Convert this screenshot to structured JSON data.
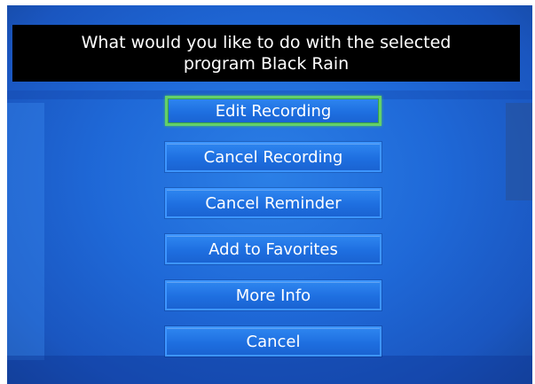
{
  "dialog": {
    "title_line1": "What would you like to do with the selected",
    "title_line2": "program Black Rain"
  },
  "menu": {
    "items": [
      {
        "label": "Edit Recording",
        "selected": true
      },
      {
        "label": "Cancel Recording",
        "selected": false
      },
      {
        "label": "Cancel Reminder",
        "selected": false
      },
      {
        "label": "Add to Favorites",
        "selected": false
      },
      {
        "label": "More Info",
        "selected": false
      },
      {
        "label": "Cancel",
        "selected": false
      }
    ]
  },
  "colors": {
    "screen_blue": "#1f69d8",
    "title_bar": "#000000",
    "button_blue": "#1e6fe0",
    "selection_outline": "#63d06a"
  }
}
